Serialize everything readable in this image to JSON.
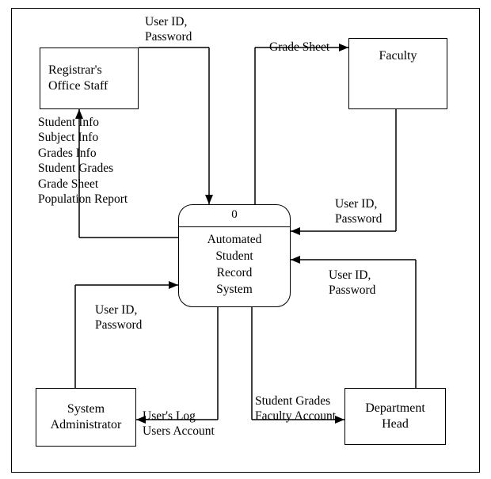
{
  "entities": {
    "registrar": "Registrar's\nOffice Staff",
    "faculty": "Faculty",
    "sysadmin": "System\nAdministrator",
    "depthead": "Department\nHead"
  },
  "process": {
    "number": "0",
    "name": "Automated\nStudent\nRecord\nSystem"
  },
  "flows": {
    "registrar_in": "User ID,\nPassword",
    "registrar_out": "Student Info\nSubject Info\nGrades Info\nStudent Grades\nGrade Sheet\nPopulation Report",
    "faculty_out": "Grade Sheet",
    "faculty_in": "User ID,\nPassword",
    "depthead_in": "User ID,\nPassword",
    "depthead_out": "Student Grades\nFaculty Account",
    "sysadmin_in": "User ID,\nPassword",
    "sysadmin_out": "User's Log\nUsers Account"
  }
}
